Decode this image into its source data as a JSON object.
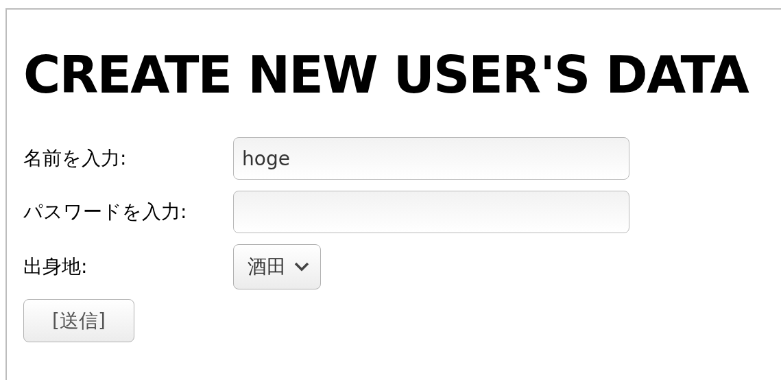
{
  "title": "CREATE NEW USER'S DATA",
  "fields": [
    {
      "kind": "text",
      "label": "名前を入力:",
      "value": "hoge"
    },
    {
      "kind": "password",
      "label": "パスワードを入力:"
    },
    {
      "kind": "select",
      "label": "出身地:",
      "value": "酒田"
    }
  ],
  "submit_button": "[送信]"
}
